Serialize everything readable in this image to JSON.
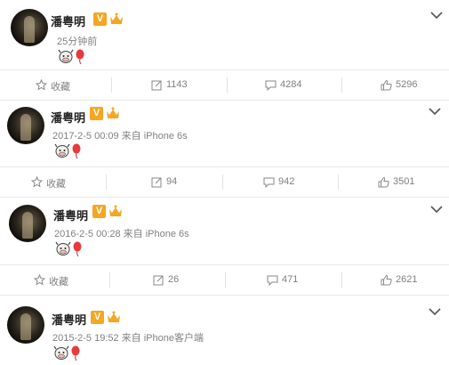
{
  "posts": [
    {
      "author": "潘粤明",
      "verified_badge": "V",
      "time": "25分钟前",
      "actions": {
        "favorite": "收藏",
        "repost": "1143",
        "comment": "4284",
        "like": "5296"
      }
    },
    {
      "author": "潘粤明",
      "verified_badge": "V",
      "time": "2017-2-5 00:09 来自 iPhone 6s",
      "actions": {
        "favorite": "收藏",
        "repost": "94",
        "comment": "942",
        "like": "3501"
      }
    },
    {
      "author": "潘粤明",
      "verified_badge": "V",
      "time": "2016-2-5 00:28 来自 iPhone 6s",
      "actions": {
        "favorite": "收藏",
        "repost": "26",
        "comment": "471",
        "like": "2621"
      }
    },
    {
      "author": "潘粤明",
      "verified_badge": "V",
      "time": "2015-2-5 19:52 来自 iPhone客户端"
    }
  ],
  "colors": {
    "badge": "#f5a623",
    "balloon": "#e83a3a",
    "text_gray": "#808080"
  },
  "icons": [
    "avatar",
    "verified-v-icon",
    "crown-level-icon",
    "cow-emoji-icon",
    "balloon-emoji-icon",
    "chevron-down-icon",
    "star-icon",
    "repost-icon",
    "comment-icon",
    "like-icon"
  ]
}
